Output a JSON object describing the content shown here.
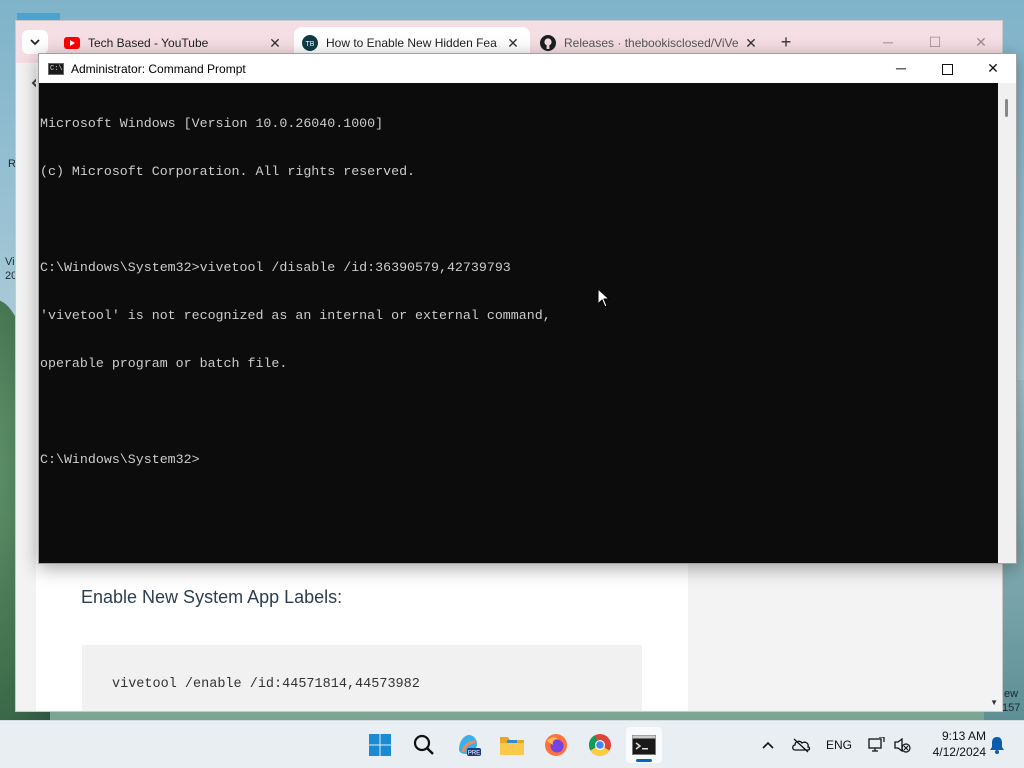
{
  "browser": {
    "tabs": [
      {
        "title": "Tech Based - YouTube",
        "favicon": "youtube-icon"
      },
      {
        "title": "How to Enable New Hidden Fea",
        "favicon": "techbased-icon"
      },
      {
        "title": "Releases · thebookisclosed/ViVe",
        "favicon": "github-icon"
      }
    ],
    "tab_close_glyph": "✕",
    "new_tab_glyph": "+",
    "page": {
      "heading": "Enable New System App Labels:",
      "code": "vivetool /enable /id:44571814,44573982"
    },
    "colors": {
      "tabbar": "#f6dfe4"
    }
  },
  "cmd": {
    "title": "Administrator: Command Prompt",
    "lines": [
      "Microsoft Windows [Version 10.0.26040.1000]",
      "(c) Microsoft Corporation. All rights reserved.",
      "",
      "C:\\Windows\\System32>vivetool /disable /id:36390579,42739793",
      "'vivetool' is not recognized as an internal or external command,",
      "operable program or batch file.",
      "",
      "C:\\Windows\\System32>"
    ],
    "colors": {
      "background": "#0c0c0c",
      "text": "#cccccc"
    }
  },
  "taskbar": {
    "apps": [
      "start-icon",
      "search-icon",
      "copilot-icon",
      "file-explorer-icon",
      "firefox-icon",
      "chrome-icon",
      "terminal-icon"
    ],
    "copilot_badge": "PRE",
    "language": "ENG",
    "time": "9:13 AM",
    "date": "4/12/2024"
  },
  "desktop": {
    "edge_text": [
      "R",
      "Vi",
      "20",
      "ew",
      "157"
    ]
  }
}
